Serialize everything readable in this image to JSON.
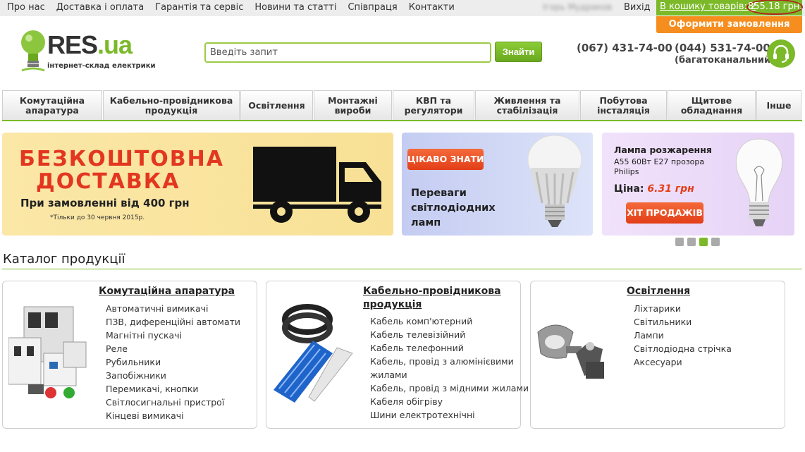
{
  "topnav": [
    "Про нас",
    "Доставка і оплата",
    "Гарантія та сервіс",
    "Новини та статті",
    "Співпраця",
    "Контакти"
  ],
  "user": {
    "name": "Ігорь Мудраков",
    "logout": "Вихід"
  },
  "cart": {
    "label": "В кошику товарів: 2",
    "sum": "855.18 грн.",
    "checkout": "Оформити замовлення"
  },
  "logo": {
    "name": "RES",
    "domain": ".ua",
    "tagline": "інтернет-склад електрики"
  },
  "search": {
    "placeholder": "Введіть запит",
    "button": "Знайти"
  },
  "contacts": {
    "phone1": "(067) 431-74-00",
    "phone2": "(044) 531-74-00",
    "phone2_note": "(багатоканальний)",
    "support_icon": "headset-icon"
  },
  "categories": [
    "Комутаційна апаратура",
    "Кабельно-провідникова продукція",
    "Освітлення",
    "Монтажні вироби",
    "КВП та регулятори",
    "Живлення та стабілізація",
    "Побутова інсталяція",
    "Щитове обладнання",
    "Інше"
  ],
  "banners": {
    "delivery": {
      "line1": "БЕЗКОШТОВНА",
      "line2": "ДОСТАВКА",
      "sub": "При замовленні від 400 грн",
      "note": "*Тільки до 30 червня 2015р."
    },
    "led": {
      "badge": "ЦІКАВО ЗНАТИ",
      "text": "Переваги світлодіодних ламп"
    },
    "lamp": {
      "title": "Лампа розжарення",
      "sub": "А55 60Вт Е27 прозора Philips",
      "price_label": "Ціна:",
      "price": "6.31 грн",
      "hit": "ХІТ ПРОДАЖІВ"
    }
  },
  "slider": {
    "count": 4,
    "active": 3
  },
  "catalog": {
    "title": "Каталог продукції",
    "cards": [
      {
        "title": "Комутаційна апаратура",
        "items": [
          "Автоматичні вимикачі",
          "ПЗВ, диференційні автомати",
          "Магнітні пускачі",
          "Реле",
          "Рубильники",
          "Запобіжники",
          "Перемикачі, кнопки",
          "Світлосигнальні пристрої",
          "Кінцеві вимикачі"
        ]
      },
      {
        "title": "Кабельно-провідникова продукція",
        "items": [
          "Кабель комп'ютерний",
          "Кабель телевізійний",
          "Кабель телефонний",
          "Кабель, провід з алюмінієвими жилами",
          "Кабель, провід з мідними жилами",
          "Кабеля обігріву",
          "Шини електротехнічні"
        ]
      },
      {
        "title": "Освітлення",
        "items": [
          "Ліхтарики",
          "Світильники",
          "Лампи",
          "Світлодіодна стрічка",
          "Аксесуари"
        ]
      }
    ]
  },
  "colors": {
    "green": "#7bb929",
    "orange": "#f58e1e",
    "red": "#e33620"
  }
}
